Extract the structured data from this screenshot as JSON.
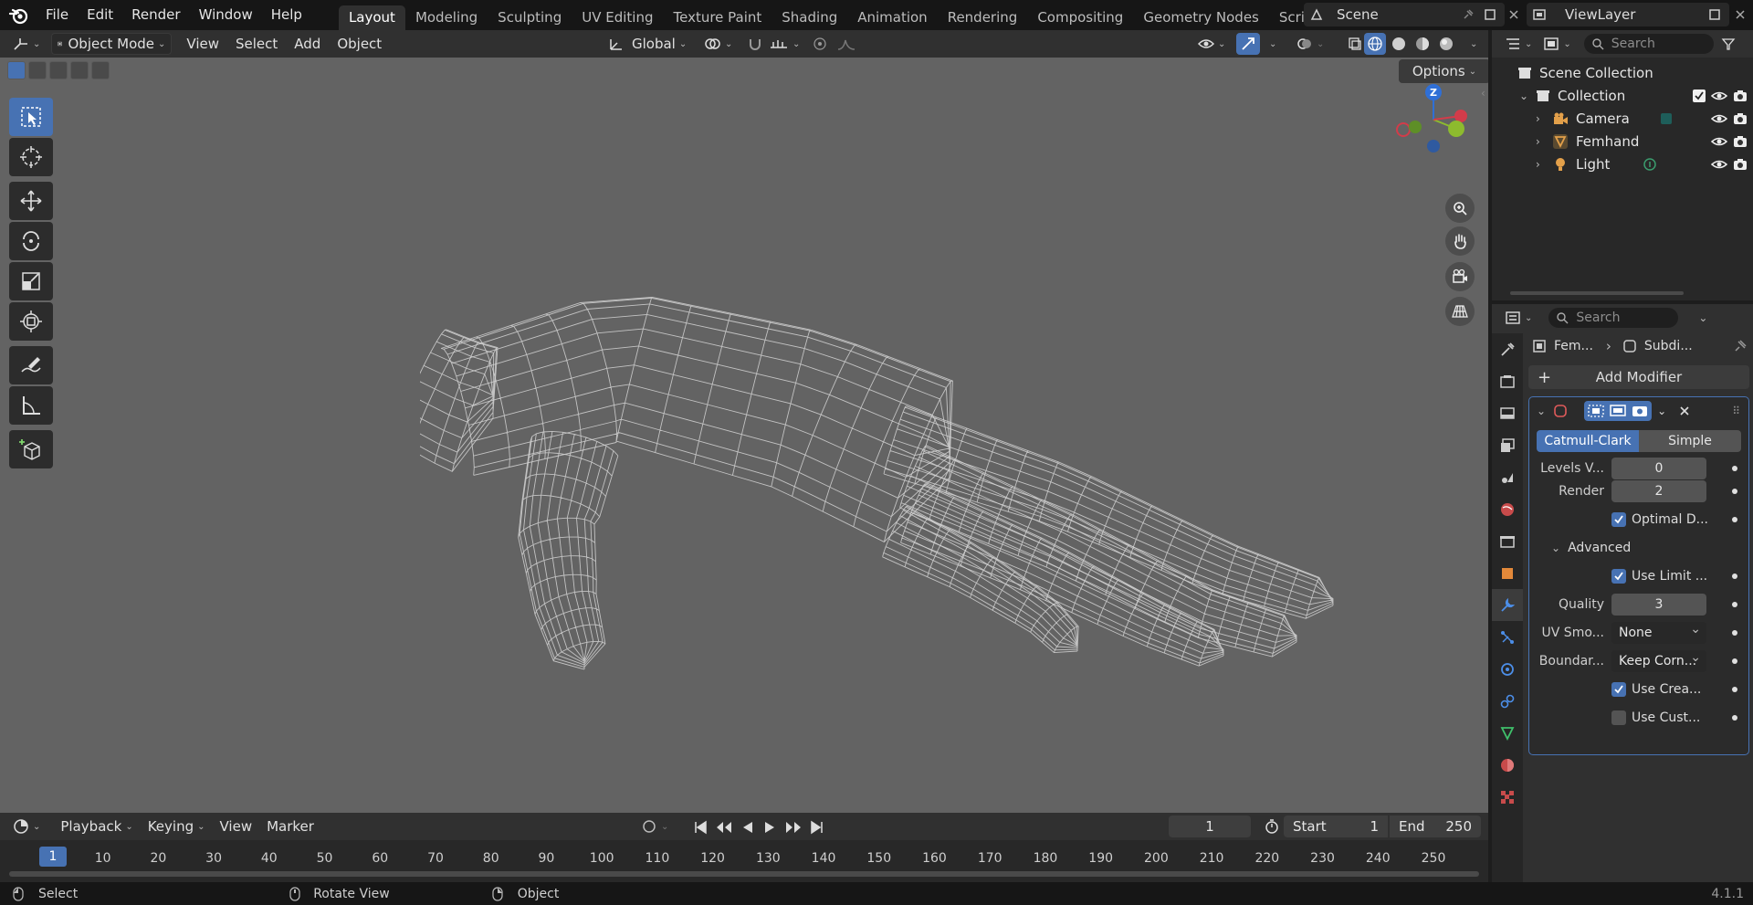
{
  "topbar": {
    "menus": [
      "File",
      "Edit",
      "Render",
      "Window",
      "Help"
    ],
    "workspaces": [
      "Layout",
      "Modeling",
      "Sculpting",
      "UV Editing",
      "Texture Paint",
      "Shading",
      "Animation",
      "Rendering",
      "Compositing",
      "Geometry Nodes",
      "Scripting"
    ],
    "active_workspace": "Layout",
    "add_workspace": "+",
    "scene": "Scene",
    "view_layer": "ViewLayer"
  },
  "viewport_header": {
    "mode": "Object Mode",
    "menus": [
      "View",
      "Select",
      "Add",
      "Object"
    ],
    "orientation": "Global",
    "options": "Options"
  },
  "gizmo": {
    "z_label": "Z"
  },
  "timeline": {
    "menus": [
      "Playback",
      "Keying",
      "View",
      "Marker"
    ],
    "current_frame": "1",
    "start_label": "Start",
    "start_value": "1",
    "end_label": "End",
    "end_value": "250",
    "ticks": [
      "1",
      "10",
      "20",
      "30",
      "40",
      "50",
      "60",
      "70",
      "80",
      "90",
      "100",
      "110",
      "120",
      "130",
      "140",
      "150",
      "160",
      "170",
      "180",
      "190",
      "200",
      "210",
      "220",
      "230",
      "240",
      "250"
    ]
  },
  "statusbar": {
    "select": "Select",
    "rotate": "Rotate View",
    "object": "Object",
    "version": "4.1.1"
  },
  "outliner": {
    "search_placeholder": "Search",
    "scene_collection": "Scene Collection",
    "collection": "Collection",
    "items": [
      {
        "name": "Camera",
        "icon": "camera-icon",
        "color": "#e3a04a"
      },
      {
        "name": "Femhand",
        "icon": "mesh-icon",
        "color": "#e3a04a"
      },
      {
        "name": "Light",
        "icon": "light-icon",
        "color": "#e3a04a"
      }
    ]
  },
  "properties": {
    "search_placeholder": "Search",
    "breadcrumb_object": "Fem...",
    "breadcrumb_modifier": "Subdi...",
    "add_modifier": "Add Modifier",
    "type_catmull": "Catmull-Clark",
    "type_simple": "Simple",
    "levels_viewport_label": "Levels V...",
    "levels_viewport": "0",
    "render_label": "Render",
    "render": "2",
    "optimal_display": "Optimal D...",
    "advanced": "Advanced",
    "use_limit": "Use Limit ...",
    "quality_label": "Quality",
    "quality": "3",
    "uv_smooth_label": "UV Smo...",
    "uv_smooth": "None",
    "boundary_label": "Boundar...",
    "boundary": "Keep Corn...",
    "use_creases": "Use Crea...",
    "use_custom": "Use Cust..."
  },
  "colors": {
    "accent": "#4772b3",
    "viewport_bg": "#636363",
    "panel": "#303030"
  }
}
